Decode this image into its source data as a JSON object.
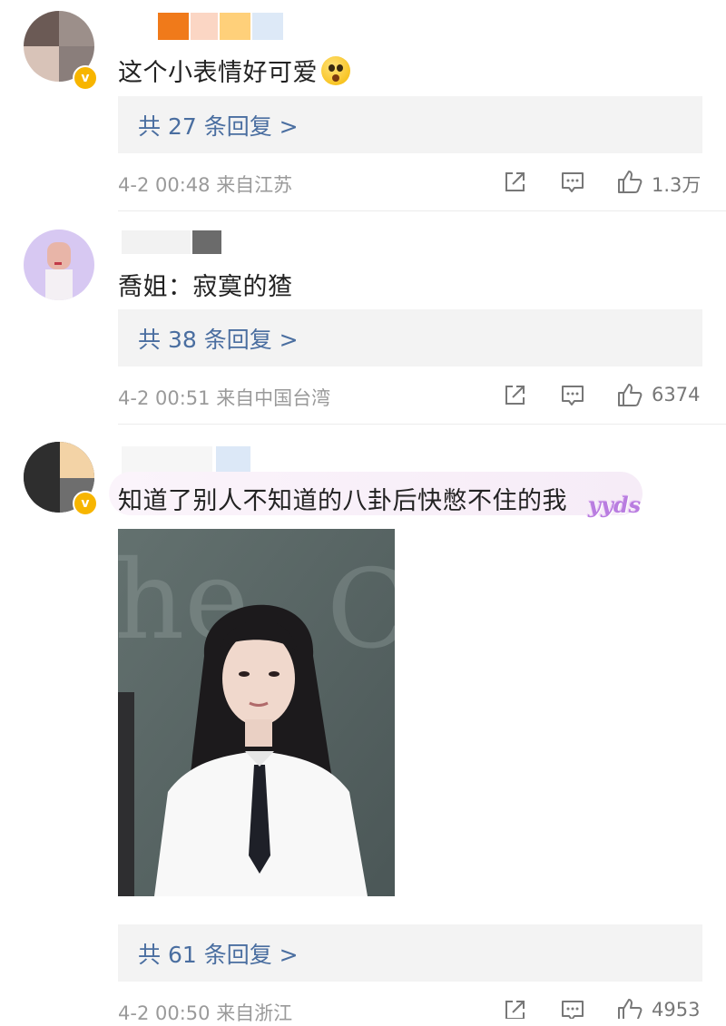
{
  "comments": [
    {
      "text": "这个小表情好可爱",
      "emoji": "astonished-face-emoji",
      "replies_label": "共 27 条回复 >",
      "time": "4-2 00:48",
      "location": "来自江苏",
      "likes": "1.3万",
      "verified": true
    },
    {
      "text": "喬姐：寂寞的猹",
      "replies_label": "共 38 条回复 >",
      "time": "4-2 00:51",
      "location": "来自中国台湾",
      "likes": "6374",
      "verified": false
    },
    {
      "text": "知道了别人不知道的八卦后快憋不住的我",
      "bubble_tag": "yyds",
      "replies_label": "共 61 条回复 >",
      "time": "4-2 00:50",
      "location": "来自浙江",
      "likes": "4953",
      "verified": true
    }
  ],
  "icons": {
    "share": "share-icon",
    "comment": "comment-icon",
    "like": "thumbs-up-icon"
  },
  "colors": {
    "reply_link": "#4a6ea0",
    "reply_bg": "#f3f3f3",
    "meta_text": "#9a9a9a",
    "verified_badge": "#f7b500"
  }
}
